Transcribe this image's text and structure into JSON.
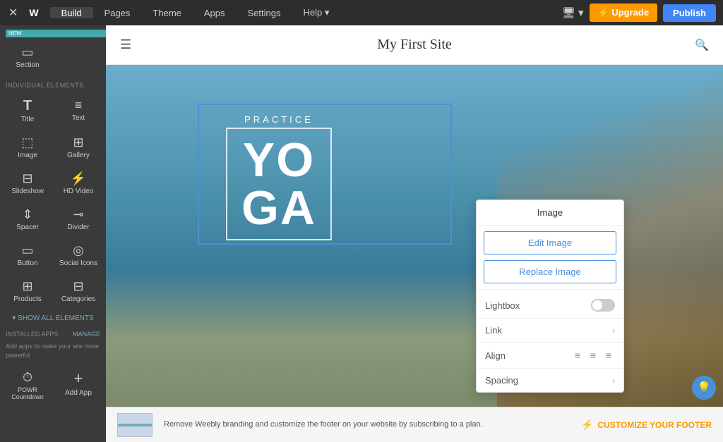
{
  "topnav": {
    "tabs": [
      {
        "label": "Build",
        "active": true
      },
      {
        "label": "Pages",
        "active": false
      },
      {
        "label": "Theme",
        "active": false
      },
      {
        "label": "Apps",
        "active": false
      },
      {
        "label": "Settings",
        "active": false
      },
      {
        "label": "Help ▾",
        "active": false
      }
    ],
    "upgrade_label": "⚡ Upgrade",
    "publish_label": "Publish"
  },
  "sidebar": {
    "new_badge": "NEW",
    "section_label": "Section",
    "individual_elements_label": "INDIVIDUAL ELEMENTS",
    "elements": [
      {
        "label": "Title",
        "icon": "T"
      },
      {
        "label": "Text",
        "icon": "☰"
      },
      {
        "label": "Image",
        "icon": "🖼"
      },
      {
        "label": "Gallery",
        "icon": "⊞"
      },
      {
        "label": "Slideshow",
        "icon": "▣"
      },
      {
        "label": "HD Video",
        "icon": "▶"
      },
      {
        "label": "Spacer",
        "icon": "↕"
      },
      {
        "label": "Divider",
        "icon": "⊸"
      },
      {
        "label": "Button",
        "icon": "▭"
      },
      {
        "label": "Social Icons",
        "icon": "◎"
      },
      {
        "label": "Products",
        "icon": "⊞"
      },
      {
        "label": "Categories",
        "icon": "⊟"
      }
    ],
    "show_all_label": "▾ SHOW ALL ELEMENTS",
    "installed_apps_label": "INSTALLED APPS",
    "manage_label": "MANAGE",
    "apps_desc": "Add apps to make your site more powerful.",
    "apps": [
      {
        "label": "POWR Countdown",
        "icon": "⏱"
      },
      {
        "label": "Add App",
        "icon": "+"
      }
    ]
  },
  "site_header": {
    "title": "My First Site"
  },
  "hero": {
    "practice_text": "PRACTICE",
    "yoga_text": "YO\nGA"
  },
  "image_panel": {
    "title": "Image",
    "edit_label": "Edit Image",
    "replace_label": "Replace Image",
    "lightbox_label": "Lightbox",
    "link_label": "Link",
    "align_label": "Align",
    "spacing_label": "Spacing",
    "lightbox_on": false
  },
  "bottom_bar": {
    "text": "Remove Weebly branding and customize the footer on your\nwebsite by subscribing to a plan.",
    "customize_label": "CUSTOMIZE YOUR FOOTER"
  }
}
